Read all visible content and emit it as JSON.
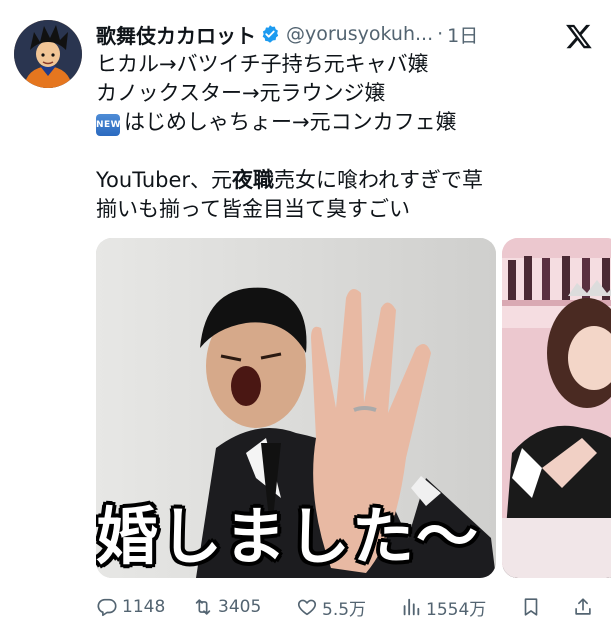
{
  "tweet": {
    "display_name": "歌舞伎カカロット",
    "handle": "@yorusyokuh...",
    "separator": "·",
    "time": "1日",
    "lines": [
      "ヒカル→バツイチ子持ち元キャバ嬢",
      "カノックスター→元ラウンジ嬢",
      "はじめしゃちょー→元コンカフェ嬢"
    ],
    "new_badge": "NEW",
    "body_line1_pre": "YouTuber、元",
    "body_line1_bold": "夜職",
    "body_line1_post": "売女に喰われすぎで草",
    "body_line2": "揃いも揃って皆金目当て臭すごい",
    "media_caption": "婚しました〜"
  },
  "actions": {
    "replies": "1148",
    "retweets": "3405",
    "likes": "5.5万",
    "views": "1554万"
  },
  "icons": {
    "avatar": "avatar-image",
    "verified": "verified-badge-icon",
    "x_logo": "x-logo-icon",
    "reply": "reply-icon",
    "retweet": "retweet-icon",
    "like": "heart-icon",
    "views": "views-icon",
    "bookmark": "bookmark-icon",
    "share": "share-icon"
  },
  "colors": {
    "text": "#0f1419",
    "secondary": "#536471",
    "verified": "#1d9bf0"
  }
}
